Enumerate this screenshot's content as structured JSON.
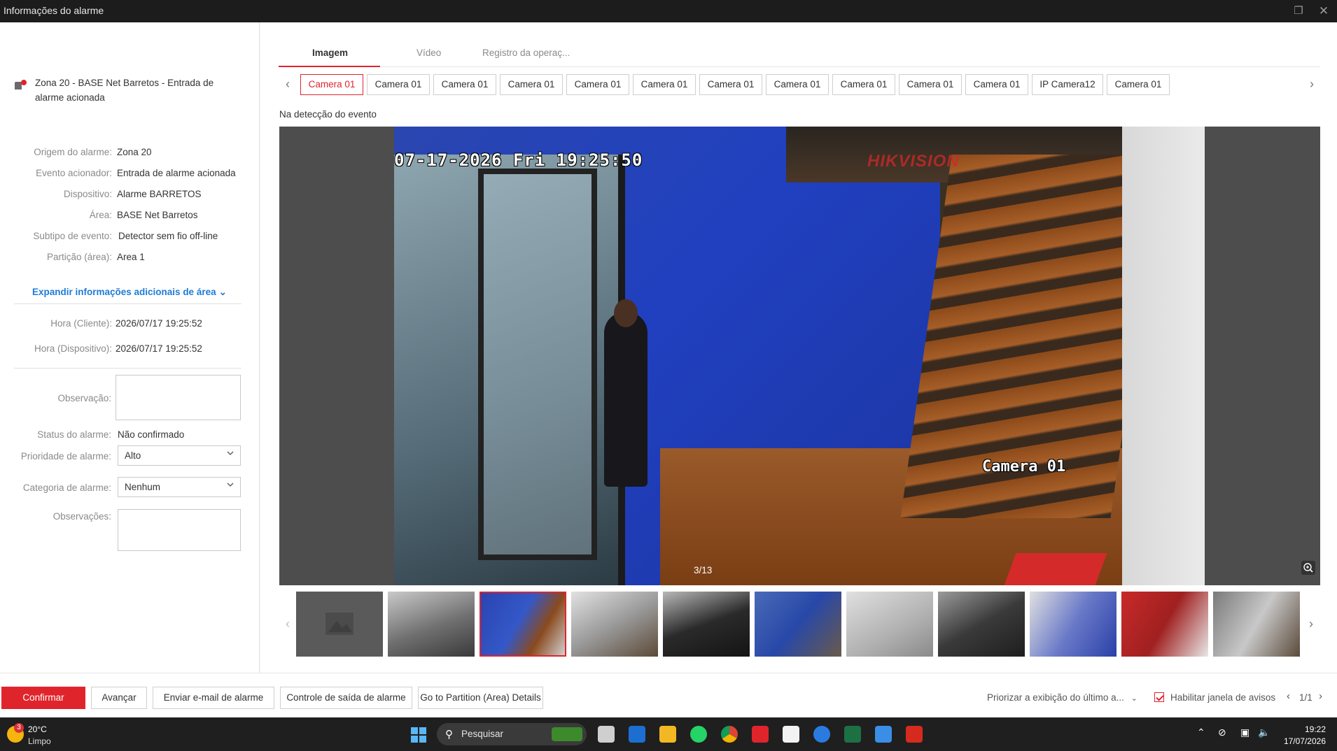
{
  "window": {
    "title": "Informações do alarme"
  },
  "alarm": {
    "title": "Zona 20 - BASE Net Barretos - Entrada de alarme acionada"
  },
  "details": [
    {
      "label": "Origem do alarme:",
      "value": "Zona 20"
    },
    {
      "label": "Evento acionador:",
      "value": "Entrada de alarme acionada"
    },
    {
      "label": "Dispositivo:",
      "value": "Alarme BARRETOS"
    },
    {
      "label": "Área:",
      "value": "BASE Net Barretos"
    },
    {
      "label": "Subtipo de evento:",
      "value": "Detector sem fio off-line"
    },
    {
      "label": "Partição (área):",
      "value": "Area 1"
    }
  ],
  "expand_label": "Expandir informações adicionais de área",
  "times": [
    {
      "label": "Hora (Cliente):",
      "value": "2026/07/17 19:25:52"
    },
    {
      "label": "Hora (Dispositivo):",
      "value": "2026/07/17 19:25:52"
    }
  ],
  "form": {
    "observation_label": "Observação:",
    "status_label": "Status do alarme:",
    "status_value": "Não confirmado",
    "priority_label": "Prioridade de alarme:",
    "priority_value": "Alto",
    "category_label": "Categoria de alarme:",
    "category_value": "Nenhum",
    "remarks_label": "Observações:"
  },
  "tabs": [
    "Imagem",
    "Vídeo",
    "Registro da operaç..."
  ],
  "cameras": [
    "Camera 01",
    "Camera 01",
    "Camera 01",
    "Camera 01",
    "Camera 01",
    "Camera 01",
    "Camera 01",
    "Camera 01",
    "Camera 01",
    "Camera 01",
    "Camera 01",
    "IP Camera12",
    "Camera 01"
  ],
  "event_label": "Na detecção do evento",
  "image": {
    "osd_time": "07-17-2026 Fri 19:25:50",
    "osd_brand": "HIKVISION",
    "osd_camera": "Camera 01",
    "counter": "3/13",
    "current_index": 3,
    "total": 13
  },
  "buttons": {
    "confirm": "Confirmar",
    "next": "Avançar",
    "email": "Enviar e-mail de alarme",
    "output": "Controle de saída de alarme",
    "partition": "Go to Partition (Area) Details"
  },
  "bottom_right": {
    "prioritize": "Priorizar a exibição do último a...",
    "enable_popup": "Habilitar janela de avisos",
    "pager": "1/1"
  },
  "taskbar": {
    "notification_count": "3",
    "temperature": "20°C",
    "weather": "Limpo",
    "search_placeholder": "Pesquisar",
    "time": "19:22",
    "date": "17/07/2026"
  },
  "colors": {
    "accent": "#e0242c",
    "link": "#1e7bd6"
  }
}
